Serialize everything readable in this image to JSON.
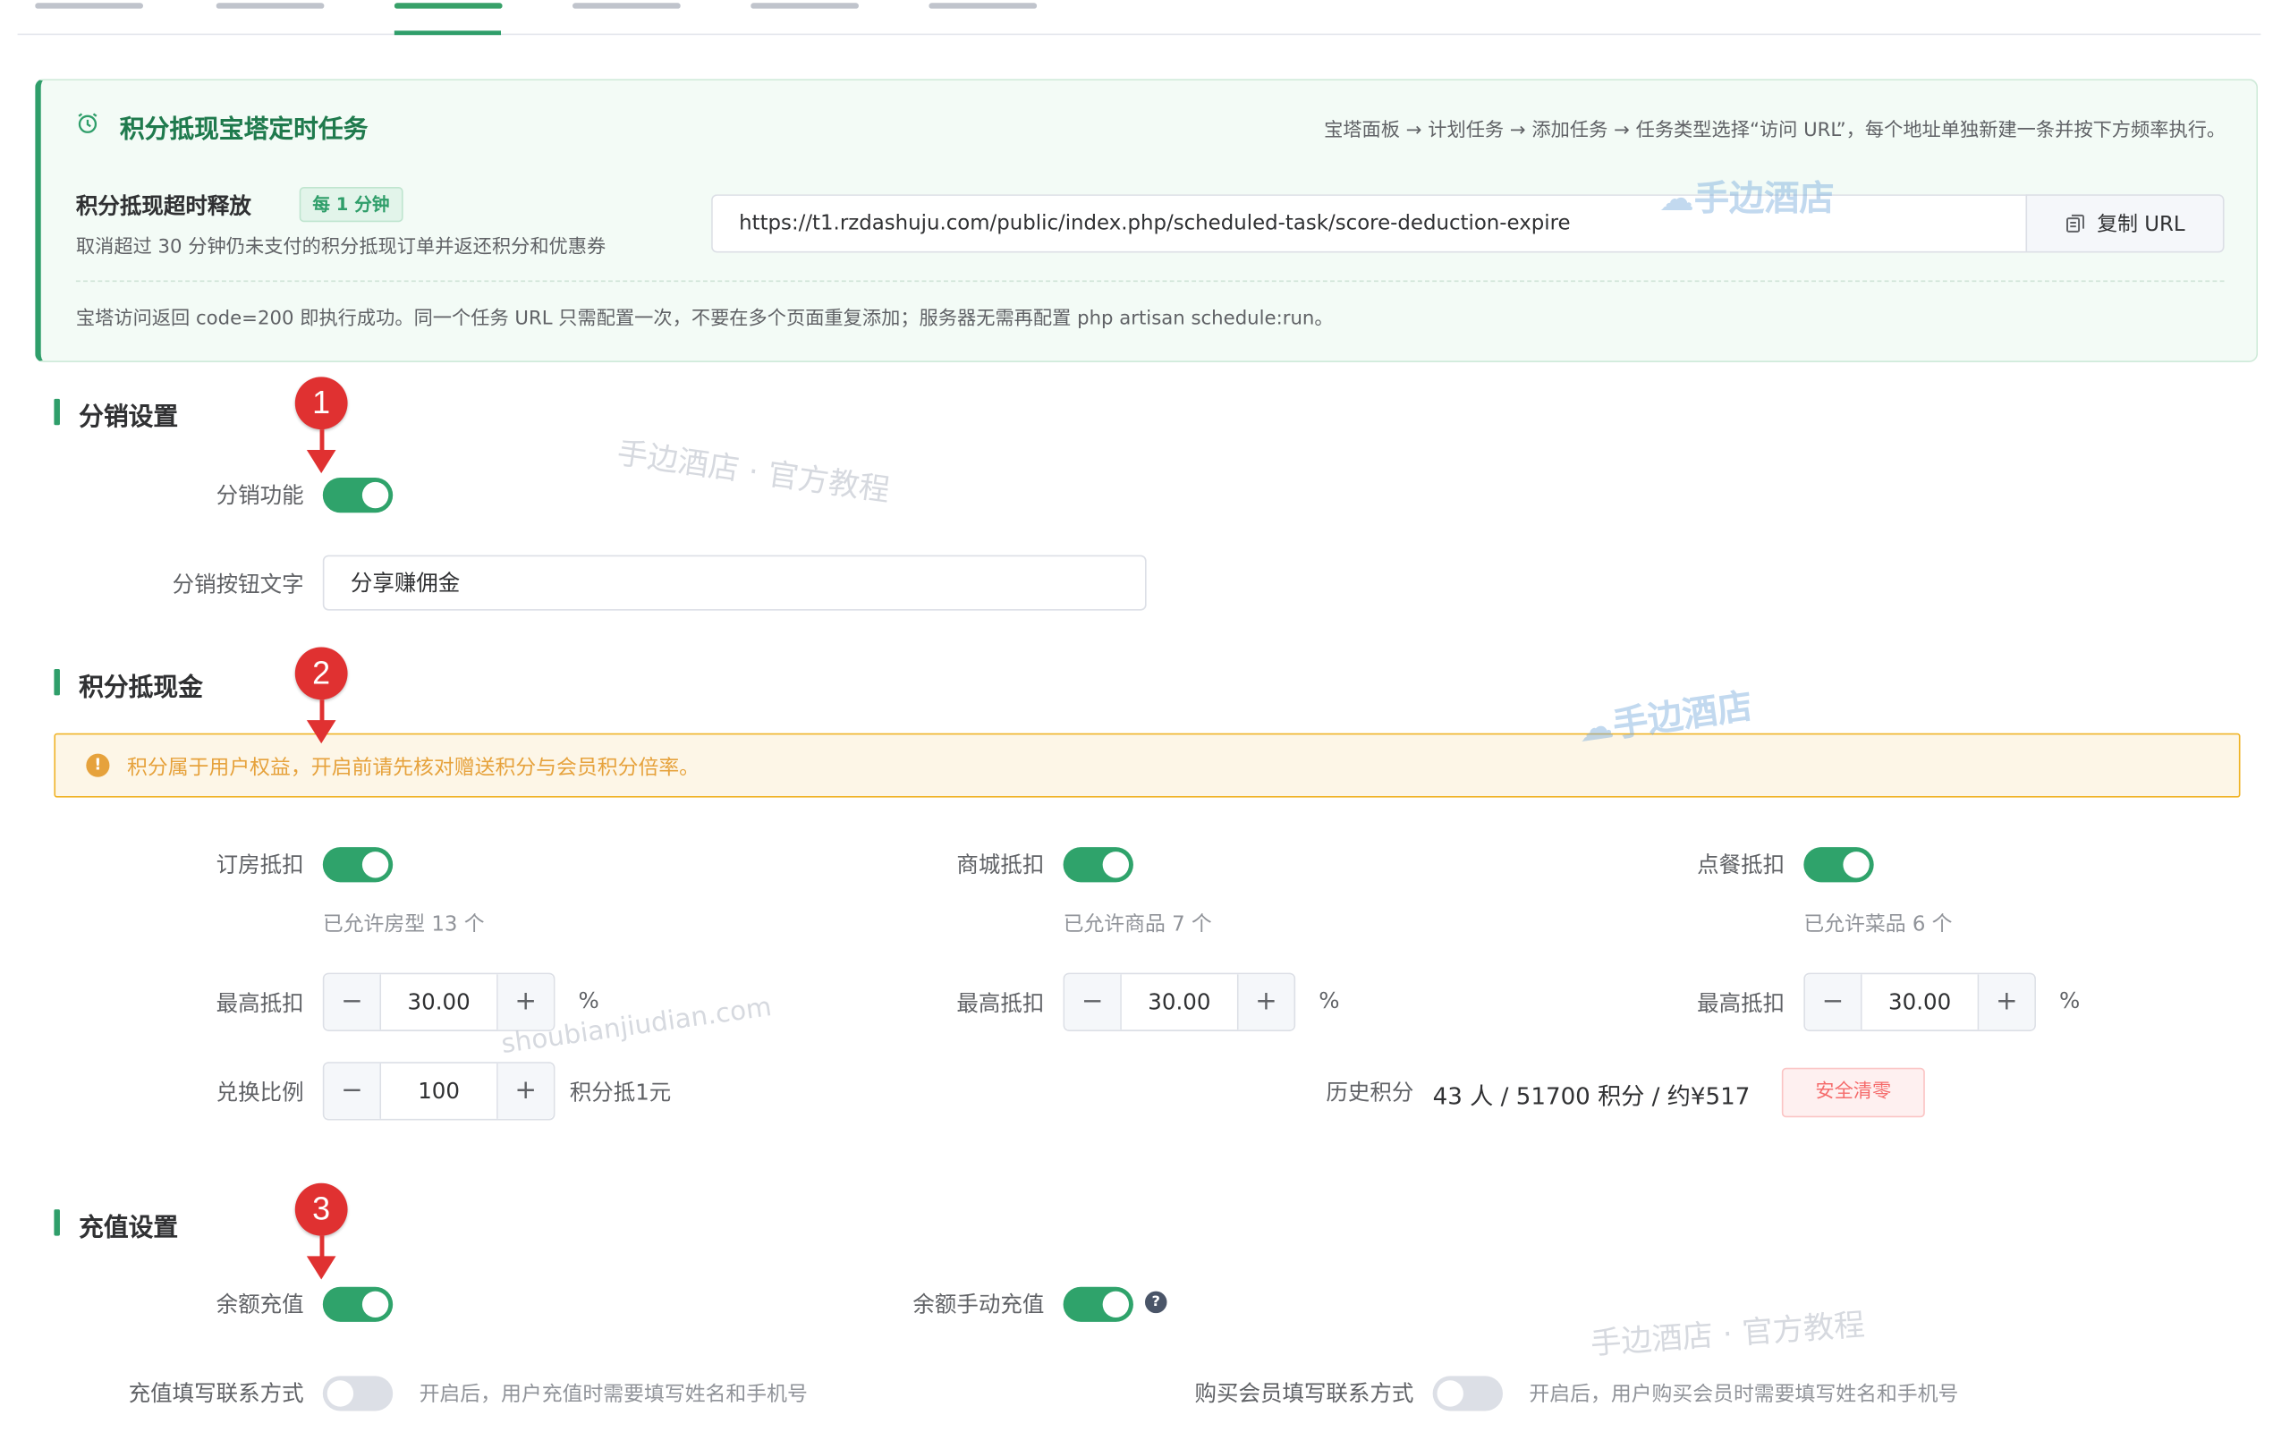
{
  "cron": {
    "title": "积分抵现宝塔定时任务",
    "path": "宝塔面板 → 计划任务 → 添加任务 → 任务类型选择“访问 URL”，每个地址单独新建一条并按下方频率执行。",
    "job_title": "积分抵现超时释放",
    "frequency": "每 1 分钟",
    "job_desc": "取消超过 30 分钟仍未支付的积分抵现订单并返还积分和优惠券",
    "url": "https://t1.rzdashuju.com/public/index.php/scheduled-task/score-deduction-expire",
    "copy_label": "复制 URL",
    "note": "宝塔访问返回 code=200 即执行成功。同一个任务 URL 只需配置一次，不要在多个页面重复添加；服务器无需再配置 php artisan schedule:run。"
  },
  "distribution": {
    "title": "分销设置",
    "toggle_label": "分销功能",
    "button_text_label": "分销按钮文字",
    "button_text_value": "分享赚佣金"
  },
  "points": {
    "title": "积分抵现金",
    "warning": "积分属于用户权益，开启前请先核对赠送积分与会员积分倍率。",
    "room_label": "订房抵扣",
    "room_hint": "已允许房型 13 个",
    "mall_label": "商城抵扣",
    "mall_hint": "已允许商品 7 个",
    "food_label": "点餐抵扣",
    "food_hint": "已允许菜品 6 个",
    "max_label": "最高抵扣",
    "max_value": "30.00",
    "percent": "%",
    "ratio_label": "兑换比例",
    "ratio_value": "100",
    "ratio_unit": "积分抵1元",
    "history_label": "历史积分",
    "history_value": "43 人 / 51700 积分 / 约¥517",
    "clear_label": "安全清零",
    "minus": "−",
    "plus": "+"
  },
  "recharge": {
    "title": "充值设置",
    "balance_label": "余额充值",
    "manual_label": "余额手动充值",
    "contact_label": "充值填写联系方式",
    "contact_hint": "开启后，用户充值时需要填写姓名和手机号",
    "member_contact_label": "购买会员填写联系方式",
    "member_contact_hint": "开启后，用户购买会员时需要填写姓名和手机号"
  },
  "markers": [
    "1",
    "2",
    "3"
  ],
  "watermarks": {
    "brand": "手边酒店",
    "tutorial": "手边酒店 · 官方教程",
    "domain": "shoubianjiudian.com"
  },
  "colors": {
    "accent": "#2f9e6a",
    "warning": "#e6a23c",
    "danger": "#f56c6c",
    "marker": "#e03131"
  },
  "icons": [
    "alarm-clock-icon",
    "copy-icon",
    "warning-icon",
    "help-icon"
  ]
}
